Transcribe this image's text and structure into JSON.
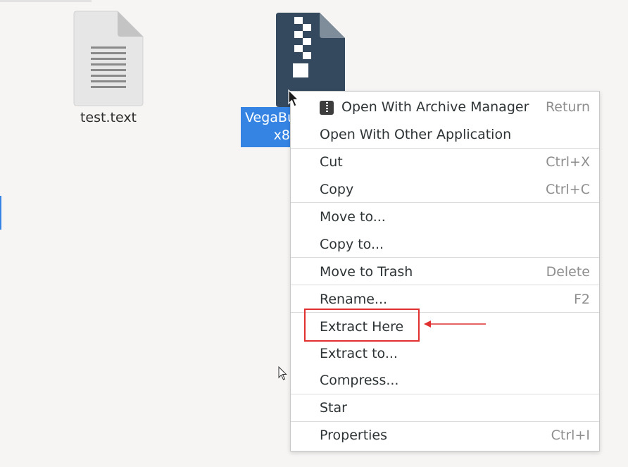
{
  "desktop": {
    "files": [
      {
        "name": "test.text",
        "icon": "text-file-icon"
      },
      {
        "name_line1": "VegaBu",
        "name_line2": "x8",
        "icon": "archive-file-icon"
      }
    ]
  },
  "context_menu": {
    "items": [
      {
        "label": "Open With Archive Manager",
        "accel": "Return",
        "icon": "archive-manager-icon"
      },
      {
        "label": "Open With Other Application",
        "accel": ""
      },
      {
        "label": "Cut",
        "accel": "Ctrl+X"
      },
      {
        "label": "Copy",
        "accel": "Ctrl+C"
      },
      {
        "label": "Move to...",
        "accel": ""
      },
      {
        "label": "Copy to...",
        "accel": ""
      },
      {
        "label": "Move to Trash",
        "accel": "Delete"
      },
      {
        "label": "Rename...",
        "accel": "F2"
      },
      {
        "label": "Extract Here",
        "accel": ""
      },
      {
        "label": "Extract to...",
        "accel": ""
      },
      {
        "label": "Compress...",
        "accel": ""
      },
      {
        "label": "Star",
        "accel": ""
      },
      {
        "label": "Properties",
        "accel": "Ctrl+I"
      }
    ]
  },
  "colors": {
    "selection": "#3584e4",
    "annotation": "#e03030",
    "archive_icon": "#34495e"
  }
}
